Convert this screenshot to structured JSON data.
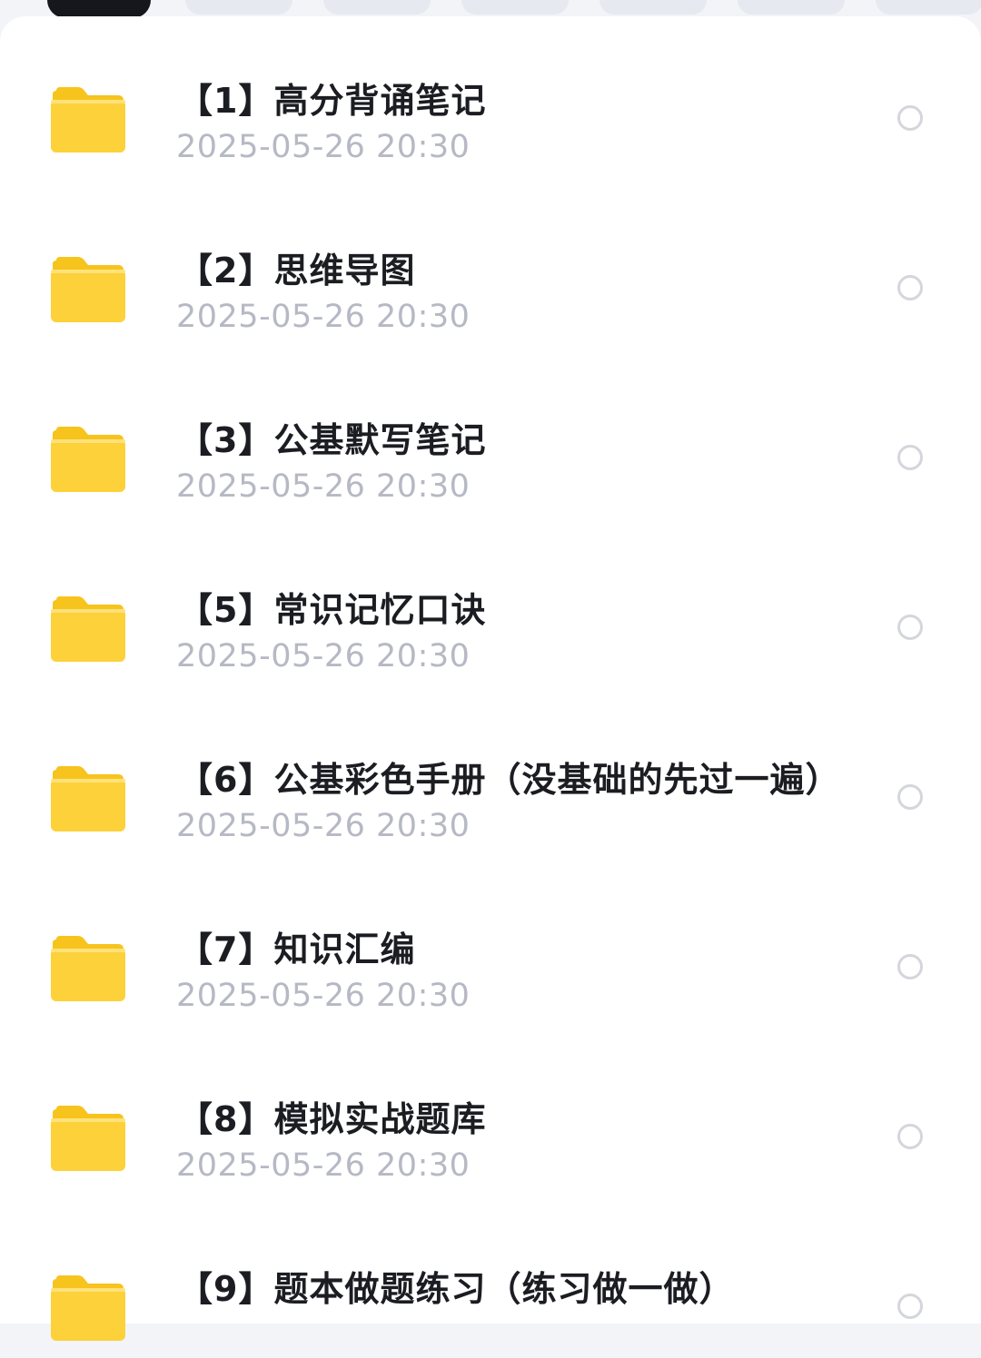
{
  "colors": {
    "folder_body": "#fcd13a",
    "folder_tab": "#f7c31d",
    "title_text": "#1b1d22",
    "date_text": "#b6b9c4",
    "radio_border": "#d4d6dc"
  },
  "files": [
    {
      "title": "【1】高分背诵笔记",
      "date": "2025-05-26  20:30",
      "selected": false
    },
    {
      "title": "【2】思维导图",
      "date": "2025-05-26  20:30",
      "selected": false
    },
    {
      "title": "【3】公基默写笔记",
      "date": "2025-05-26  20:30",
      "selected": false
    },
    {
      "title": "【5】常识记忆口诀",
      "date": "2025-05-26  20:30",
      "selected": false
    },
    {
      "title": "【6】公基彩色手册（没基础的先过一遍）",
      "date": "2025-05-26  20:30",
      "selected": false
    },
    {
      "title": "【7】知识汇编",
      "date": "2025-05-26  20:30",
      "selected": false
    },
    {
      "title": "【8】模拟实战题库",
      "date": "2025-05-26  20:30",
      "selected": false
    },
    {
      "title": "【9】题本做题练习（练习做一做）",
      "date": "",
      "selected": false
    }
  ],
  "icons": {
    "folder": "folder-icon",
    "select": "radio-circle-icon"
  }
}
